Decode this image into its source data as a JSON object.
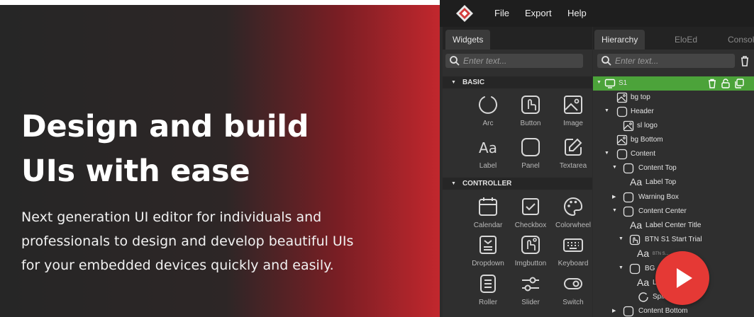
{
  "hero": {
    "headline_line1": "Design and build",
    "headline_line2": "UIs with ease",
    "sub_line1": "Next generation UI editor for individuals and",
    "sub_line2": "professionals to design and develop beautiful UIs",
    "sub_line3": "for your embedded devices quickly and easily."
  },
  "menu": {
    "file": "File",
    "export": "Export",
    "help": "Help"
  },
  "widgets_panel": {
    "tab": "Widgets",
    "search_placeholder": "Enter text...",
    "sections": [
      {
        "title": "BASIC",
        "items": [
          {
            "label": "Arc",
            "icon": "arc-icon"
          },
          {
            "label": "Button",
            "icon": "button-icon"
          },
          {
            "label": "Image",
            "icon": "image-icon"
          },
          {
            "label": "Label",
            "icon": "label-icon"
          },
          {
            "label": "Panel",
            "icon": "panel-icon"
          },
          {
            "label": "Textarea",
            "icon": "textarea-icon"
          }
        ]
      },
      {
        "title": "CONTROLLER",
        "items": [
          {
            "label": "Calendar",
            "icon": "calendar-icon"
          },
          {
            "label": "Checkbox",
            "icon": "checkbox-icon"
          },
          {
            "label": "Colorwheel",
            "icon": "colorwheel-icon"
          },
          {
            "label": "Dropdown",
            "icon": "dropdown-icon"
          },
          {
            "label": "Imgbutton",
            "icon": "imgbutton-icon"
          },
          {
            "label": "Keyboard",
            "icon": "keyboard-icon"
          },
          {
            "label": "Roller",
            "icon": "roller-icon"
          },
          {
            "label": "Slider",
            "icon": "slider-icon"
          },
          {
            "label": "Switch",
            "icon": "switch-icon"
          }
        ]
      }
    ]
  },
  "hierarchy_panel": {
    "tabs": [
      "Hierarchy",
      "EloEd",
      "Console"
    ],
    "search_placeholder": "Enter text...",
    "rows": [
      {
        "label": "S1",
        "icon": "screen-icon",
        "selected": true,
        "expanded": true
      },
      {
        "label": "bg top",
        "icon": "image-icon"
      },
      {
        "label": "Header",
        "icon": "panel-icon",
        "expanded": true
      },
      {
        "label": "sl logo",
        "icon": "image-icon"
      },
      {
        "label": "bg Bottom",
        "icon": "image-icon"
      },
      {
        "label": "Content",
        "icon": "panel-icon",
        "expanded": true
      },
      {
        "label": "Content Top",
        "icon": "panel-icon",
        "expanded": true
      },
      {
        "label": "Label Top",
        "icon": "label-icon"
      },
      {
        "label": "Warning Box",
        "icon": "panel-icon",
        "expanded": false
      },
      {
        "label": "Content Center",
        "icon": "panel-icon",
        "expanded": true
      },
      {
        "label": "Label Center Title",
        "icon": "label-icon"
      },
      {
        "label": "BTN S1 Start Trial",
        "icon": "imgbutton-icon",
        "expanded": true
      },
      {
        "label": "BTN S...",
        "icon": "label-icon"
      },
      {
        "label": "BG",
        "icon": "panel-icon",
        "expanded": true
      },
      {
        "label": "La",
        "icon": "label-icon"
      },
      {
        "label": "Spinner",
        "icon": "spinner-icon"
      },
      {
        "label": "Content Bottom",
        "icon": "panel-icon",
        "expanded": false
      }
    ]
  },
  "colors": {
    "accent_green": "#4ca33a",
    "play_red": "#e53935",
    "hero_red": "#c0272d"
  }
}
